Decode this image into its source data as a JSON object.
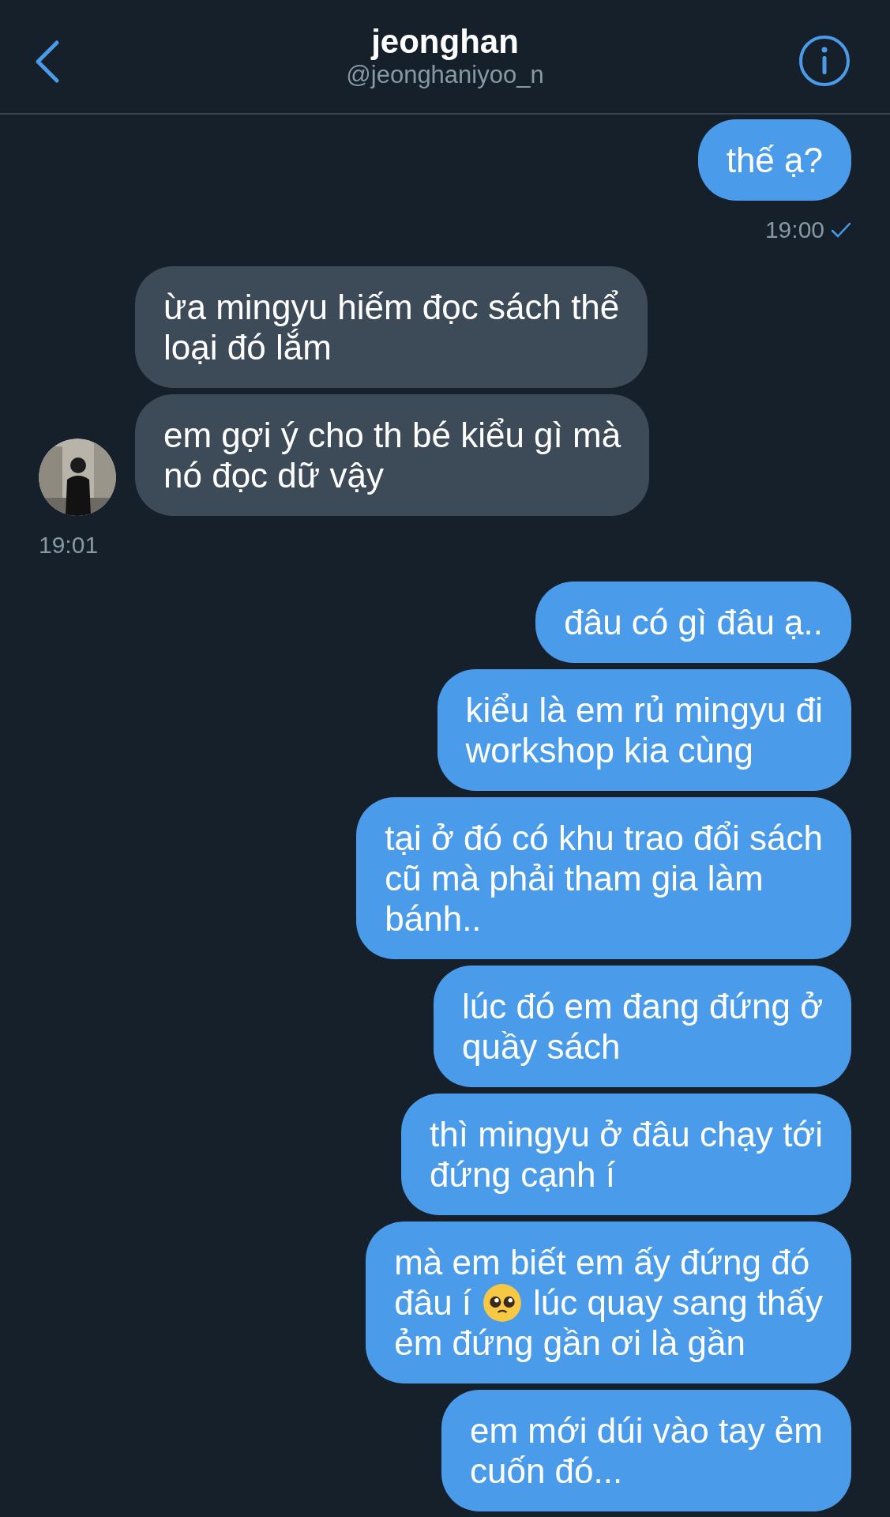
{
  "header": {
    "title": "jeonghan",
    "handle": "@jeonghaniyoo_n"
  },
  "groups": [
    {
      "kind": "sent",
      "messages": [
        {
          "text": "thế ạ?"
        }
      ],
      "time": "19:00",
      "read": true
    },
    {
      "kind": "received",
      "messages": [
        {
          "text": "ừa mingyu hiếm đọc sách thể\nloại đó lắm"
        },
        {
          "text": "em gợi ý cho th bé kiểu gì mà\nnó đọc dữ vậy"
        }
      ],
      "time": "19:01",
      "read": false
    },
    {
      "kind": "sent",
      "messages": [
        {
          "text": "đâu có gì đâu ạ.."
        },
        {
          "text": "kiểu là em rủ mingyu đi\nworkshop kia cùng"
        },
        {
          "text": "tại ở đó có khu trao đổi sách\ncũ mà phải tham gia làm\nbánh.."
        },
        {
          "text": "lúc đó em đang đứng ở\nquầy sách"
        },
        {
          "text": "thì mingyu ở đâu chạy tới\nđứng cạnh í"
        },
        {
          "lines": [
            [
              {
                "kind": "text",
                "text": "mà em biết em ấy đứng đó"
              }
            ],
            [
              {
                "kind": "text",
                "text": "đâu í"
              },
              {
                "kind": "emoji"
              },
              {
                "kind": "text",
                "text": "lúc quay sang thấy"
              }
            ],
            [
              {
                "kind": "text",
                "text": "ẻm đứng gần ơi là gần"
              }
            ]
          ]
        },
        {
          "text": "em mới dúi vào tay ẻm\ncuốn đó..."
        }
      ]
    }
  ]
}
